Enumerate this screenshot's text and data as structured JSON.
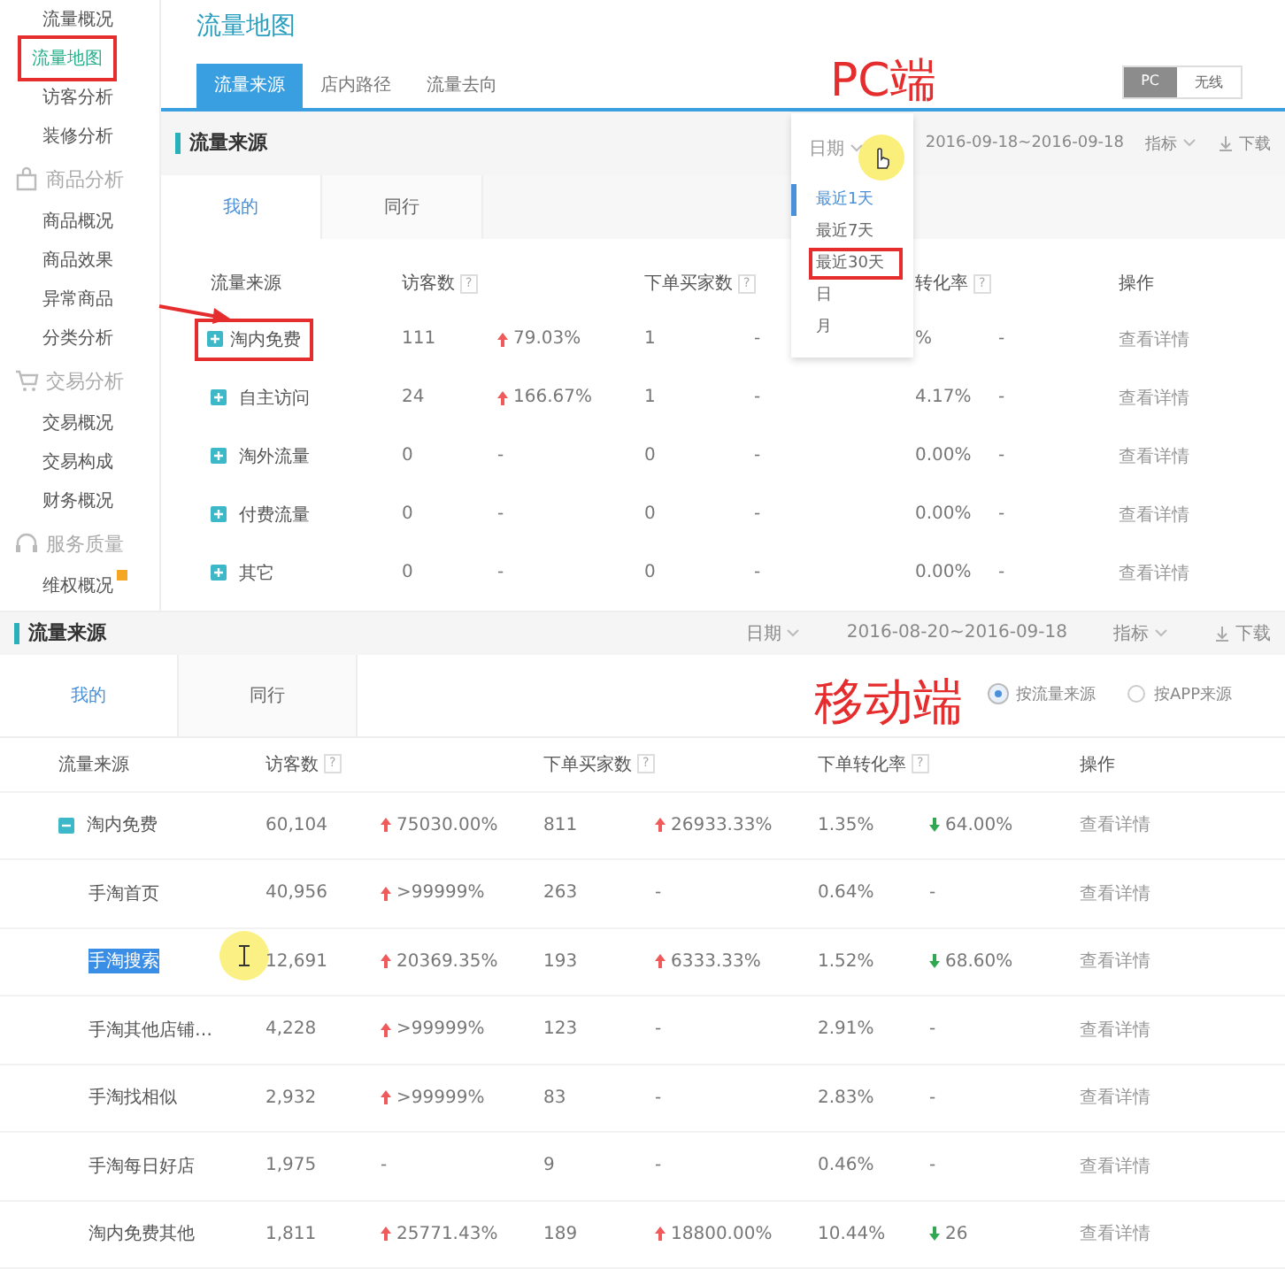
{
  "pc": {
    "annotation": "PC端",
    "sidebar": {
      "items": [
        {
          "kind": "item",
          "label": "流量概况",
          "selected": false
        },
        {
          "kind": "item",
          "label": "流量地图",
          "selected": true,
          "annotated": true
        },
        {
          "kind": "item",
          "label": "访客分析",
          "selected": false
        },
        {
          "kind": "item",
          "label": "装修分析",
          "selected": false
        },
        {
          "kind": "group",
          "label": "商品分析"
        },
        {
          "kind": "item",
          "label": "商品概况",
          "selected": false
        },
        {
          "kind": "item",
          "label": "商品效果",
          "selected": false
        },
        {
          "kind": "item",
          "label": "异常商品",
          "selected": false
        },
        {
          "kind": "item",
          "label": "分类分析",
          "selected": false
        },
        {
          "kind": "group",
          "label": "交易分析"
        },
        {
          "kind": "item",
          "label": "交易概况",
          "selected": false
        },
        {
          "kind": "item",
          "label": "交易构成",
          "selected": false
        },
        {
          "kind": "item",
          "label": "财务概况",
          "selected": false
        },
        {
          "kind": "group",
          "label": "服务质量"
        },
        {
          "kind": "item",
          "label": "维权概况",
          "selected": false,
          "flagged": true
        }
      ]
    },
    "page_title": "流量地图",
    "tabs": [
      {
        "label": "流量来源",
        "selected": true
      },
      {
        "label": "店内路径",
        "selected": false
      },
      {
        "label": "流量去向",
        "selected": false
      }
    ],
    "device_toggle": [
      {
        "label": "PC",
        "selected": true
      },
      {
        "label": "无线",
        "selected": false
      }
    ],
    "section_title": "流量来源",
    "date_label": "日期",
    "date_range": "2016-09-18~2016-09-18",
    "metrics": "指标",
    "download": "下载",
    "date_menu": [
      {
        "label": "最近1天",
        "selected": true
      },
      {
        "label": "最近7天",
        "selected": false
      },
      {
        "label": "最近30天",
        "selected": false,
        "annotated": true
      },
      {
        "label": "日",
        "selected": false
      },
      {
        "label": "月",
        "selected": false
      }
    ],
    "subtabs": [
      {
        "label": "我的",
        "selected": true
      },
      {
        "label": "同行",
        "selected": false
      }
    ],
    "table": {
      "columns": [
        {
          "label": "流量来源"
        },
        {
          "label": "访客数",
          "help": "?"
        },
        {
          "label": "下单买家数",
          "help": "?"
        },
        {
          "label": "转化率",
          "help": "?"
        },
        {
          "label": "操作"
        }
      ],
      "rows": [
        {
          "name": "淘内免费",
          "expanded": false,
          "annotated": true,
          "visitors": "111",
          "visitors_change": {
            "up": true,
            "value": "79.03%"
          },
          "buyers": "1",
          "buyers_change": {
            "value": "-"
          },
          "conversion": "%",
          "conversion_change": {
            "value": "-"
          },
          "action": "查看详情"
        },
        {
          "name": "自主访问",
          "expanded": false,
          "visitors": "24",
          "visitors_change": {
            "up": true,
            "value": "166.67%"
          },
          "buyers": "1",
          "buyers_change": {
            "value": "-"
          },
          "conversion": "4.17%",
          "conversion_change": {
            "value": "-"
          },
          "action": "查看详情"
        },
        {
          "name": "淘外流量",
          "expanded": false,
          "visitors": "0",
          "visitors_change": {
            "value": "-"
          },
          "buyers": "0",
          "buyers_change": {
            "value": "-"
          },
          "conversion": "0.00%",
          "conversion_change": {
            "value": "-"
          },
          "action": "查看详情"
        },
        {
          "name": "付费流量",
          "expanded": false,
          "visitors": "0",
          "visitors_change": {
            "value": "-"
          },
          "buyers": "0",
          "buyers_change": {
            "value": "-"
          },
          "conversion": "0.00%",
          "conversion_change": {
            "value": "-"
          },
          "action": "查看详情"
        },
        {
          "name": "其它",
          "expanded": false,
          "visitors": "0",
          "visitors_change": {
            "value": "-"
          },
          "buyers": "0",
          "buyers_change": {
            "value": "-"
          },
          "conversion": "0.00%",
          "conversion_change": {
            "value": "-"
          },
          "action": "查看详情"
        }
      ]
    }
  },
  "mobile": {
    "annotation": "移动端",
    "section_title": "流量来源",
    "date_label": "日期",
    "date_range": "2016-08-20~2016-09-18",
    "metrics": "指标",
    "download": "下载",
    "subtabs": [
      {
        "label": "我的",
        "selected": true
      },
      {
        "label": "同行",
        "selected": false
      }
    ],
    "source_options": [
      {
        "label": "按流量来源",
        "selected": true
      },
      {
        "label": "按APP来源",
        "selected": false
      }
    ],
    "table": {
      "columns": [
        {
          "label": "流量来源"
        },
        {
          "label": "访客数",
          "help": "?"
        },
        {
          "label": "下单买家数",
          "help": "?"
        },
        {
          "label": "下单转化率",
          "help": "?"
        },
        {
          "label": "操作"
        }
      ],
      "rows": [
        {
          "name": "淘内免费",
          "expanded": true,
          "selected": false,
          "visitors": "60,104",
          "visitors_change": {
            "up": true,
            "value": "75030.00%"
          },
          "buyers": "811",
          "buyers_change": {
            "up": true,
            "value": "26933.33%"
          },
          "conversion": "1.35%",
          "conversion_change": {
            "up": false,
            "value": "64.00%"
          },
          "action": "查看详情",
          "children": [
            {
              "name": "手淘首页",
              "selected": false,
              "visitors": "40,956",
              "visitors_change": {
                "up": true,
                "value": ">99999%"
              },
              "buyers": "263",
              "buyers_change": {
                "value": "-"
              },
              "conversion": "0.64%",
              "conversion_change": {
                "value": "-"
              },
              "action": "查看详情"
            },
            {
              "name": "手淘搜索",
              "selected": true,
              "cursor": true,
              "visitors": "12,691",
              "visitors_change": {
                "up": true,
                "value": "20369.35%"
              },
              "buyers": "193",
              "buyers_change": {
                "up": true,
                "value": "6333.33%"
              },
              "conversion": "1.52%",
              "conversion_change": {
                "up": false,
                "value": "68.60%"
              },
              "action": "查看详情"
            },
            {
              "name": "手淘其他店铺…",
              "selected": false,
              "visitors": "4,228",
              "visitors_change": {
                "up": true,
                "value": ">99999%"
              },
              "buyers": "123",
              "buyers_change": {
                "value": "-"
              },
              "conversion": "2.91%",
              "conversion_change": {
                "value": "-"
              },
              "action": "查看详情"
            },
            {
              "name": "手淘找相似",
              "selected": false,
              "visitors": "2,932",
              "visitors_change": {
                "up": true,
                "value": ">99999%"
              },
              "buyers": "83",
              "buyers_change": {
                "value": "-"
              },
              "conversion": "2.83%",
              "conversion_change": {
                "value": "-"
              },
              "action": "查看详情"
            },
            {
              "name": "手淘每日好店",
              "selected": false,
              "visitors": "1,975",
              "visitors_change": {
                "value": "-"
              },
              "buyers": "9",
              "buyers_change": {
                "value": "-"
              },
              "conversion": "0.46%",
              "conversion_change": {
                "value": "-"
              },
              "action": "查看详情"
            },
            {
              "name": "淘内免费其他",
              "selected": false,
              "visitors": "1,811",
              "visitors_change": {
                "up": true,
                "value": "25771.43%"
              },
              "buyers": "189",
              "buyers_change": {
                "up": true,
                "value": "18800.00%"
              },
              "conversion": "10.44%",
              "conversion_change": {
                "up": false,
                "value": "26"
              },
              "action": "查看详情"
            }
          ]
        }
      ]
    }
  }
}
